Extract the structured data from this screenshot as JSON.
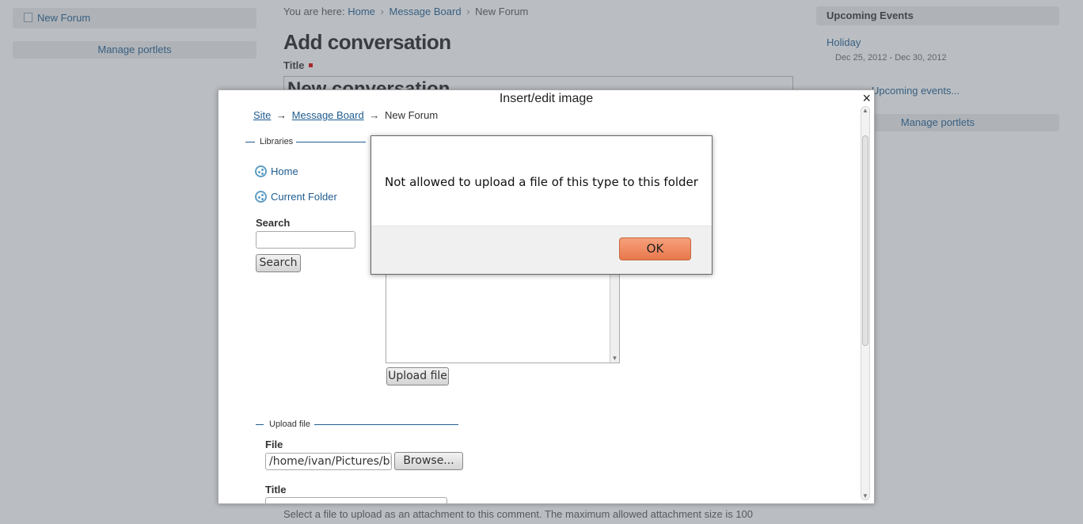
{
  "left_portlet": {
    "forum_link": "New Forum",
    "manage_portlets": "Manage portlets"
  },
  "breadcrumb": {
    "prefix": "You are here:",
    "items": [
      "Home",
      "Message Board",
      "New Forum"
    ],
    "separator": "›"
  },
  "page": {
    "title": "Add conversation",
    "title_label": "Title",
    "title_value": "New conversation",
    "hint": "Select a file to upload as an attachment to this comment. The maximum allowed attachment size is 100"
  },
  "events": {
    "header": "Upcoming Events",
    "event_name": "Holiday",
    "event_dates": "Dec 25, 2012 - Dec 30, 2012",
    "more_link": "Upcoming events...",
    "manage_portlets": "Manage portlets"
  },
  "image_dialog": {
    "title": "Insert/edit image",
    "close_glyph": "×",
    "path": {
      "site": "Site",
      "arrow": "→",
      "message_board": "Message Board",
      "current": "New Forum"
    },
    "libraries_legend": "Libraries",
    "libraries": [
      "Home",
      "Current Folder"
    ],
    "search_label": "Search",
    "search_value": "",
    "search_button": "Search",
    "upload_button": "Upload file",
    "upload_legend": "Upload file",
    "file_label": "File",
    "file_value": "/home/ivan/Pictures/bl",
    "browse_button": "Browse...",
    "title_label": "Title",
    "title_value": ""
  },
  "alert": {
    "message": "Not allowed to upload a file of this type to this folder",
    "ok_label": "OK"
  },
  "colors": {
    "link": "#205c90",
    "ok_button": "#e8784c",
    "overlay": "#5a646e"
  }
}
